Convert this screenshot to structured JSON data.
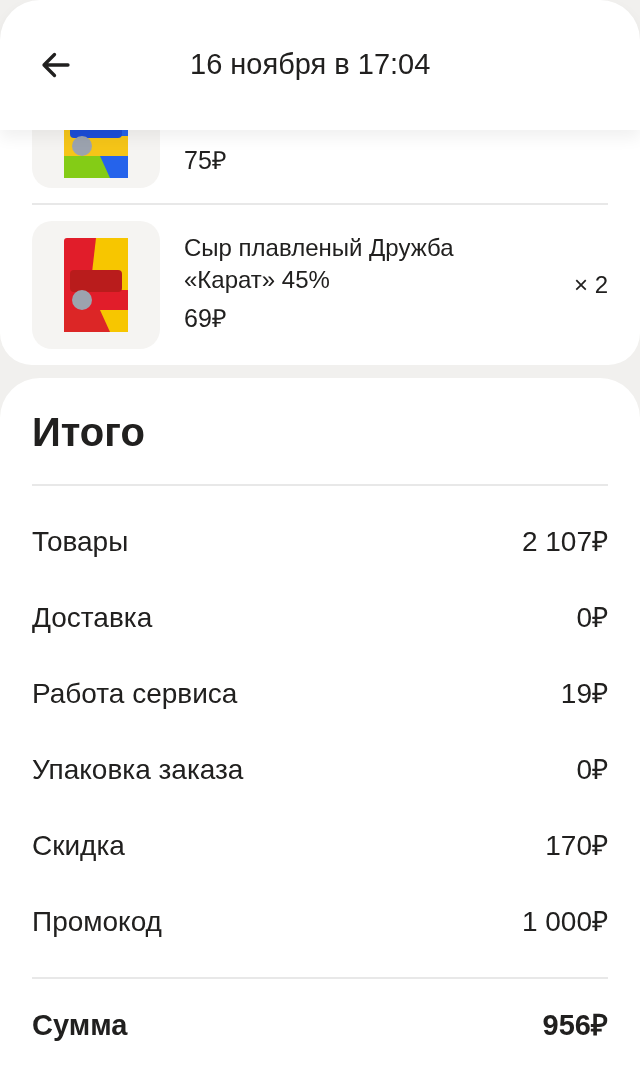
{
  "header": {
    "title": "16 ноября в 17:04"
  },
  "items": [
    {
      "kind": "cut",
      "price": "75₽"
    },
    {
      "kind": "full",
      "name": "Сыр плавленый Дружба «Карат» 45%",
      "price": "69₽",
      "quantity": "× 2"
    }
  ],
  "summary": {
    "title": "Итого",
    "rows": [
      {
        "label": "Товары",
        "value": "2 107₽"
      },
      {
        "label": "Доставка",
        "value": "0₽"
      },
      {
        "label": "Работа сервиса",
        "value": "19₽"
      },
      {
        "label": "Упаковка заказа",
        "value": "0₽"
      },
      {
        "label": "Скидка",
        "value": "170₽"
      },
      {
        "label": "Промокод",
        "value": "1 000₽"
      }
    ],
    "total": {
      "label": "Сумма",
      "value": "956₽"
    }
  }
}
